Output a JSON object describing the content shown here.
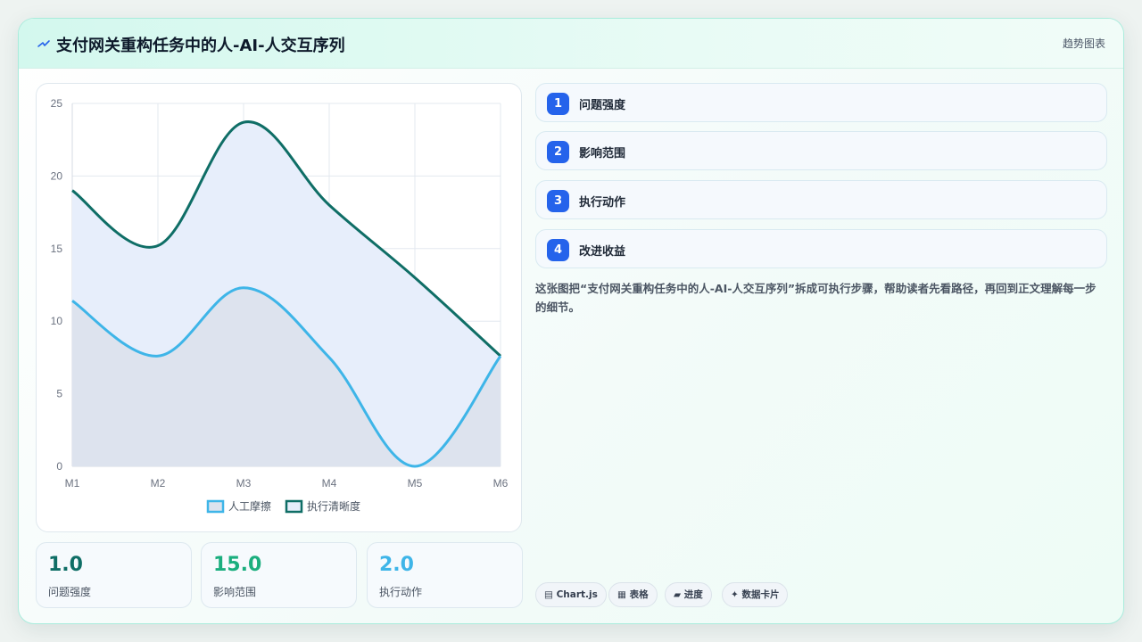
{
  "header": {
    "icon": "zigzag-icon",
    "title": "支付网关重构任务中的人-AI-人交互序列",
    "tag": "趋势图表"
  },
  "chart_data": {
    "type": "area",
    "categories": [
      "M1",
      "M2",
      "M3",
      "M4",
      "M5",
      "M6"
    ],
    "y_ticks": [
      "0",
      "5",
      "10",
      "15",
      "20",
      "25"
    ],
    "ylim": [
      0,
      25
    ],
    "grid": true,
    "legend_position": "bottom",
    "series": [
      {
        "name": "人工摩擦",
        "values": [
          11.4,
          7.6,
          12.3,
          7.5,
          0,
          7.6
        ],
        "color": "#3eb5e8",
        "fill": "#dde3ee"
      },
      {
        "name": "执行清晰度",
        "values": [
          19,
          15.2,
          23.7,
          18,
          13,
          7.6
        ],
        "color": "#0f6e66",
        "fill": "#e7eefb"
      }
    ]
  },
  "stats": [
    {
      "value": "1.0",
      "label": "问题强度",
      "color": "#0f6e66"
    },
    {
      "value": "15.0",
      "label": "影响范围",
      "color": "#1aae7e"
    },
    {
      "value": "2.0",
      "label": "执行动作",
      "color": "#3eb5e8"
    }
  ],
  "steps": [
    {
      "num": "1",
      "label": "问题强度"
    },
    {
      "num": "2",
      "label": "影响范围"
    },
    {
      "num": "3",
      "label": "执行动作"
    },
    {
      "num": "4",
      "label": "改进收益"
    }
  ],
  "description": "这张图把“支付网关重构任务中的人-AI-人交互序列”拆成可执行步骤，帮助读者先看路径，再回到正文理解每一步的细节。",
  "chips": [
    {
      "icon": "chart-icon",
      "label": "▤ Chart.js"
    },
    {
      "icon": "table-icon",
      "label": "▦ 表格"
    },
    {
      "icon": "progress-icon",
      "label": "▰ 进度"
    },
    {
      "icon": "sparkle-icon",
      "label": "✦ 数据卡片"
    }
  ]
}
